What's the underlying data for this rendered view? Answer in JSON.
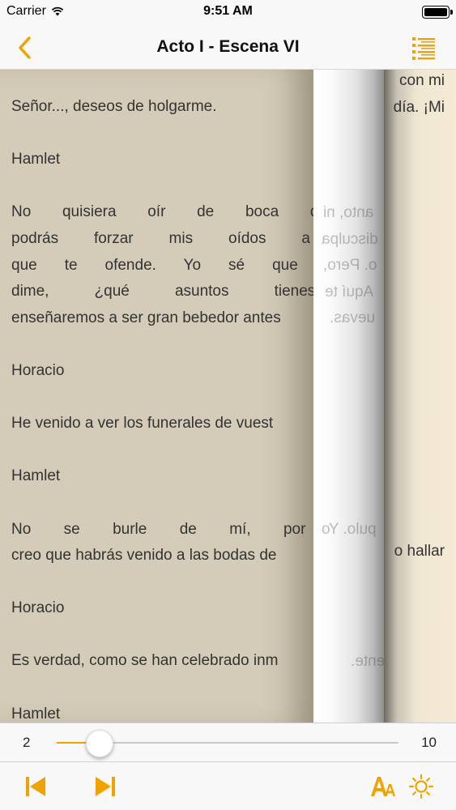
{
  "status_bar": {
    "carrier": "Carrier",
    "time": "9:51 AM",
    "wifi_icon": "wifi-icon",
    "battery_icon": "battery-icon"
  },
  "nav": {
    "title": "Acto I - Escena VI",
    "back_icon": "chevron-left-icon",
    "toc_icon": "list-icon",
    "accent_color": "#f0a300"
  },
  "reader": {
    "top_partial_right": "con mi",
    "paragraphs": [
      "Señor..., deseos de holgarme.",
      "Hamlet",
      "No quisiera oír de boca de tu enemi",
      "podrás forzar mis oídos a que admit",
      "que te ofende. Yo sé que no eres de",
      "dime, ¿qué asuntos tienes en Els",
      "enseñaremos a ser gran bebedor antes",
      "Horacio",
      "He venido a ver los funerales de vuest",
      "Hamlet",
      "No se burle de mí, por Dios, señor",
      "creo que habrás venido a las bodas de",
      "Horacio",
      "Es verdad, como se han celebrado inm",
      "Hamlet"
    ],
    "right_fragments": [
      "día. ¡Mi",
      "o hallar"
    ],
    "mirrored_fragments": [
      "anto, ni",
      "disculpa",
      "o. Pero,",
      "Aquí te",
      "uevas.",
      "pulo. Yo",
      "ente."
    ]
  },
  "slider": {
    "min_label": "2",
    "max_label": "10",
    "min": 2,
    "max": 10,
    "value": 3
  },
  "toolbar": {
    "prev_icon": "skip-previous-icon",
    "next_icon": "skip-next-icon",
    "font_icon": "font-size-icon",
    "brightness_icon": "brightness-icon"
  }
}
